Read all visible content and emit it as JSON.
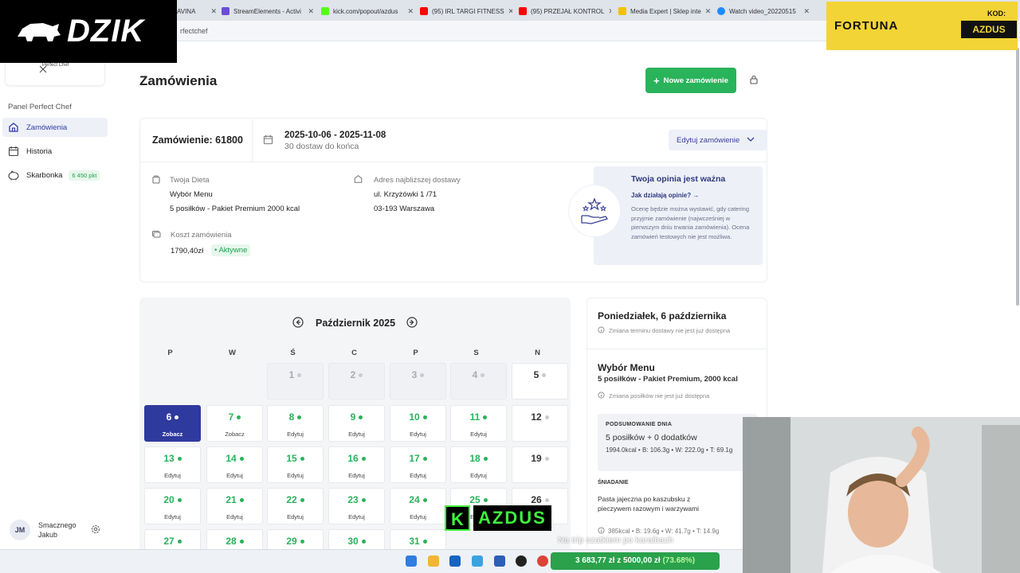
{
  "browser": {
    "tabs": [
      {
        "label": "AVINA",
        "color": "#888888"
      },
      {
        "label": "StreamElements - Activi",
        "color": "#6b4cd8"
      },
      {
        "label": "kick.com/popout/azdus",
        "color": "#53fc18"
      },
      {
        "label": "(95) IRL TARGI FITNESS",
        "color": "#ff0000"
      },
      {
        "label": "(95) PRZEJAŁ KONTROL",
        "color": "#ff0000"
      },
      {
        "label": "Media Expert | Sklep inte",
        "color": "#f2c200"
      },
      {
        "label": "Watch video_20220515",
        "color": "#1a8cff"
      }
    ],
    "url": "rfectchef"
  },
  "overlays": {
    "logo_text": "DZIK",
    "sponsor_brand": "FORTUNA",
    "sponsor_code_label": "KOD:",
    "sponsor_code": "AZDUS",
    "kick_letter": "K",
    "kick_name": "AZDUS",
    "subtitle": "Na trip szatkiem po karaibach",
    "goal_progress": "3 683,77 zł z 5000,00 zł",
    "goal_percent": "(73.68%)"
  },
  "sidebar": {
    "logo_text": "Perfect Chef",
    "panel_title": "Panel Perfect Chef",
    "items": [
      {
        "label": "Zamówienia",
        "icon": "home-icon"
      },
      {
        "label": "Historia",
        "icon": "calendar-icon"
      },
      {
        "label": "Skarbonka",
        "icon": "piggy-bank-icon",
        "badge": "6 450 pkt"
      }
    ],
    "user_initials": "JM",
    "user_greeting": "Smacznego",
    "user_name": "Jakub"
  },
  "main": {
    "title": "Zamówienia",
    "new_order_label": "Nowe zamówienie",
    "order": {
      "number_label": "Zamówienie: 61800",
      "date_range": "2025-10-06 - 2025-11-08",
      "remaining": "30 dostaw do końca",
      "edit_label": "Edytuj zamówienie",
      "diet_label": "Twoja Dieta",
      "diet_name": "Wybór Menu",
      "diet_plan": "5 posiłków - Pakiet Premium 2000 kcal",
      "address_label": "Adres najbliższej dostawy",
      "address_street": "ul. Krzyżówki 1 /71",
      "address_city": "03-193 Warszawa",
      "cost_label": "Koszt zamówienia",
      "cost_value": "1790,40zł",
      "status": "Aktywne"
    },
    "opinion": {
      "title": "Twoja opinia jest ważna",
      "link": "Jak działają opinie?",
      "text": "Ocenę będzie można wystawić, gdy catering przyjmie zamówienie (najwcześniej w pierwszym dniu trwania zamówienia). Ocena zamówień testowych nie jest możliwa."
    }
  },
  "calendar": {
    "month": "Październik 2025",
    "weekdays": [
      "P",
      "W",
      "Ś",
      "C",
      "P",
      "S",
      "N"
    ],
    "days": [
      {
        "n": "1",
        "a": "",
        "t": "off"
      },
      {
        "n": "2",
        "a": "",
        "t": "off"
      },
      {
        "n": "3",
        "a": "",
        "t": "off"
      },
      {
        "n": "4",
        "a": "",
        "t": "off"
      },
      {
        "n": "5",
        "a": "",
        "t": "hol"
      },
      {
        "n": "6",
        "a": "Zobacz",
        "t": "sel"
      },
      {
        "n": "7",
        "a": "Zobacz",
        "t": "on"
      },
      {
        "n": "8",
        "a": "Edytuj",
        "t": "on"
      },
      {
        "n": "9",
        "a": "Edytuj",
        "t": "on"
      },
      {
        "n": "10",
        "a": "Edytuj",
        "t": "on"
      },
      {
        "n": "11",
        "a": "Edytuj",
        "t": "on"
      },
      {
        "n": "12",
        "a": "",
        "t": "hol"
      },
      {
        "n": "13",
        "a": "Edytuj",
        "t": "on"
      },
      {
        "n": "14",
        "a": "Edytuj",
        "t": "on"
      },
      {
        "n": "15",
        "a": "Edytuj",
        "t": "on"
      },
      {
        "n": "16",
        "a": "Edytuj",
        "t": "on"
      },
      {
        "n": "17",
        "a": "Edytuj",
        "t": "on"
      },
      {
        "n": "18",
        "a": "Edytuj",
        "t": "on"
      },
      {
        "n": "19",
        "a": "",
        "t": "hol"
      },
      {
        "n": "20",
        "a": "Edytuj",
        "t": "on"
      },
      {
        "n": "21",
        "a": "Edytuj",
        "t": "on"
      },
      {
        "n": "22",
        "a": "Edytuj",
        "t": "on"
      },
      {
        "n": "23",
        "a": "Edytuj",
        "t": "on"
      },
      {
        "n": "24",
        "a": "Edytuj",
        "t": "on"
      },
      {
        "n": "25",
        "a": "Edytuj",
        "t": "on"
      },
      {
        "n": "26",
        "a": "",
        "t": "hol"
      },
      {
        "n": "27",
        "a": "",
        "t": "on"
      },
      {
        "n": "28",
        "a": "",
        "t": "on"
      },
      {
        "n": "29",
        "a": "",
        "t": "on"
      },
      {
        "n": "30",
        "a": "",
        "t": "on"
      },
      {
        "n": "31",
        "a": "",
        "t": "on"
      }
    ]
  },
  "day_panel": {
    "day_title": "Poniedziałek, 6 października",
    "delivery_note": "Zmiana terminu dostawy nie jest już dostępna",
    "menu_title": "Wybór Menu",
    "menu_package": "5 posiłków - Pakiet Premium, 2000 kcal",
    "meals_note": "Zmiana posiłków nie jest już dostępna",
    "summary_header": "PODSUMOWANIE DNIA",
    "summary_meals": "5 posiłków + 0 dodatków",
    "summary_macros": "1994.0kcal • B: 106.3g • W: 222.0g • T: 69.1g",
    "breakfast_header": "ŚNIADANIE",
    "breakfast_dish": "Pasta jajeczna po kaszubsku z pieczywem razowym i warzywami",
    "breakfast_macros": "385kcal • B: 19.6g • W: 41.7g • T: 14.9g"
  }
}
